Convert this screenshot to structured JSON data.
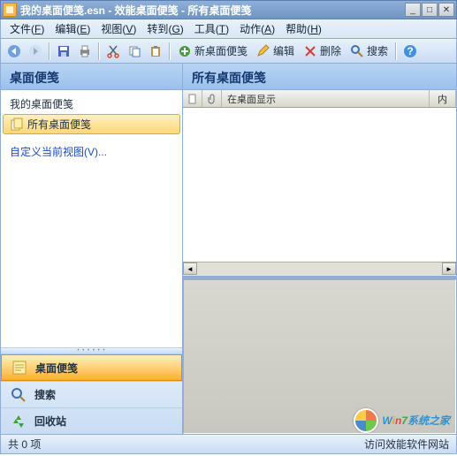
{
  "title": "我的桌面便笺.esn - 效能桌面便笺 - 所有桌面便笺",
  "menus": {
    "file": {
      "label": "文件",
      "key": "F"
    },
    "edit": {
      "label": "编辑",
      "key": "E"
    },
    "view": {
      "label": "视图",
      "key": "V"
    },
    "goto": {
      "label": "转到",
      "key": "G"
    },
    "tools": {
      "label": "工具",
      "key": "T"
    },
    "action": {
      "label": "动作",
      "key": "A"
    },
    "help": {
      "label": "帮助",
      "key": "H"
    }
  },
  "toolbar": {
    "new_note": "新桌面便笺",
    "edit": "编辑",
    "delete": "删除",
    "search": "搜索"
  },
  "sidebar": {
    "header": "桌面便笺",
    "tree": {
      "root": "我的桌面便笺",
      "all_notes": "所有桌面便笺",
      "custom_view": "自定义当前视图(V)..."
    },
    "nav": {
      "notes": "桌面便笺",
      "search": "搜索",
      "recycle": "回收站"
    }
  },
  "content": {
    "header": "所有桌面便笺",
    "columns": {
      "show_on_desktop": "在桌面显示",
      "content": "内"
    }
  },
  "status": {
    "count": "共 0 项",
    "link": "访问效能软件网站"
  },
  "watermark": {
    "prefix": "Win7",
    "suffix": "系统之家"
  }
}
